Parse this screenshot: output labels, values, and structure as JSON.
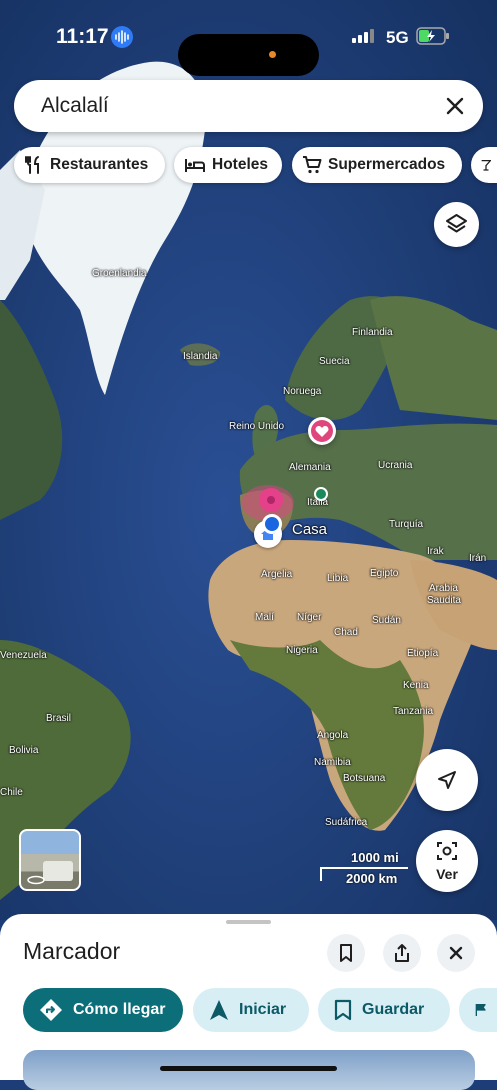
{
  "status_bar": {
    "time": "11:17",
    "network": "5G"
  },
  "search": {
    "query": "Alcalalí"
  },
  "chips": [
    {
      "label": "Restaurantes",
      "icon": "fork-knife-icon"
    },
    {
      "label": "Hoteles",
      "icon": "bed-icon"
    },
    {
      "label": "Supermercados",
      "icon": "cart-icon"
    },
    {
      "label": "",
      "icon": "cocktail-icon"
    }
  ],
  "map": {
    "labels": {
      "greenland": "Groenlandia",
      "iceland": "Islandia",
      "finland": "Finlandia",
      "sweden": "Suecia",
      "norway": "Noruega",
      "uk": "Reino Unido",
      "germany": "Alemania",
      "ukraine": "Ucrania",
      "italy": "Italia",
      "turkey": "Turquía",
      "irak": "Irak",
      "iran": "Irán",
      "algeria": "Argelia",
      "libya": "Libia",
      "egypt": "Egipto",
      "saudi_1": "Arabia",
      "saudi_2": "Saudita",
      "mali": "Malí",
      "niger": "Níger",
      "chad": "Chad",
      "sudan": "Sudán",
      "nigeria": "Nigeria",
      "ethiopia": "Etiopía",
      "kenya": "Kenia",
      "tanzania": "Tanzania",
      "angola": "Angola",
      "namibia": "Namibia",
      "botswana": "Botsuana",
      "south_africa": "Sudáfrica",
      "venezuela": "Venezuela",
      "brazil": "Brasil",
      "bolivia": "Bolivia",
      "chile": "Chile"
    },
    "home_label": "Casa",
    "scale": {
      "miles": "1000 mi",
      "km": "2000 km"
    },
    "view_button": "Ver"
  },
  "sheet": {
    "title": "Marcador",
    "actions": [
      {
        "label": "Cómo llegar",
        "icon": "directions-icon"
      },
      {
        "label": "Iniciar",
        "icon": "navigation-arrow-icon"
      },
      {
        "label": "Guardar",
        "icon": "bookmark-icon"
      },
      {
        "label": "",
        "icon": "flag-icon"
      }
    ]
  },
  "colors": {
    "accent": "#0b6e79",
    "chip_bg": "#ffffff",
    "secondary_pill": "#d8eef5",
    "pin_pink": "#e0457b"
  }
}
